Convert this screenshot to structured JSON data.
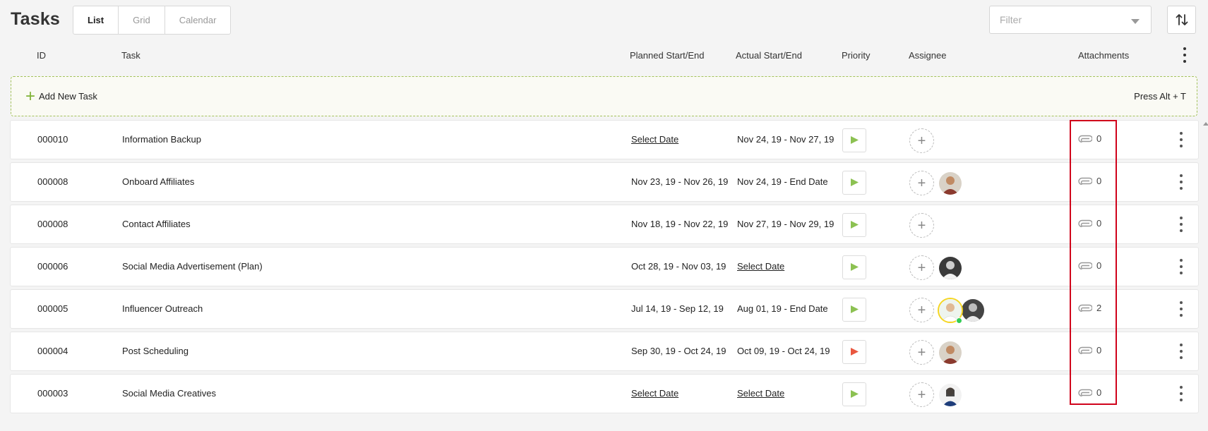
{
  "header": {
    "title": "Tasks",
    "tabs": [
      {
        "label": "List",
        "active": true
      },
      {
        "label": "Grid",
        "active": false
      },
      {
        "label": "Calendar",
        "active": false
      }
    ],
    "filter": {
      "placeholder": "Filter",
      "value": ""
    }
  },
  "columns": {
    "id": "ID",
    "task": "Task",
    "planned": "Planned Start/End",
    "actual": "Actual Start/End",
    "priority": "Priority",
    "assignee": "Assignee",
    "attachments": "Attachments"
  },
  "add_task": {
    "label": "Add New Task",
    "shortcut": "Press Alt + T"
  },
  "colors": {
    "accent_green": "#7fb236",
    "flag_green": "#8cc152",
    "flag_red": "#e9573f",
    "highlight_red": "#d0021b"
  },
  "rows": [
    {
      "id": "000010",
      "task": "Information Backup",
      "planned": "Select Date",
      "actual": "Nov 24, 19 - Nov 27, 19",
      "priority": "green",
      "attachments": "0"
    },
    {
      "id": "000008",
      "task": "Onboard Affiliates",
      "planned": "Nov 23, 19 - Nov 26, 19",
      "actual": "Nov 24, 19 - End Date",
      "priority": "green",
      "attachments": "0"
    },
    {
      "id": "000008",
      "task": "Contact Affiliates",
      "planned": "Nov 18, 19 - Nov 22, 19",
      "actual": "Nov 27, 19 - Nov 29, 19",
      "priority": "green",
      "attachments": "0"
    },
    {
      "id": "000006",
      "task": "Social Media Advertisement (Plan)",
      "planned": "Oct 28, 19 - Nov 03, 19",
      "actual": "Select Date",
      "priority": "green",
      "attachments": "0"
    },
    {
      "id": "000005",
      "task": "Influencer Outreach",
      "planned": "Jul 14, 19 - Sep 12, 19",
      "actual": "Aug 01, 19 - End Date",
      "priority": "green",
      "attachments": "2"
    },
    {
      "id": "000004",
      "task": "Post Scheduling",
      "planned": "Sep 30, 19 - Oct 24, 19",
      "actual": "Oct 09, 19 - Oct 24, 19",
      "priority": "red",
      "attachments": "0"
    },
    {
      "id": "000003",
      "task": "Social Media Creatives",
      "planned": "Select Date",
      "actual": "Select Date",
      "priority": "green",
      "attachments": "0"
    }
  ]
}
